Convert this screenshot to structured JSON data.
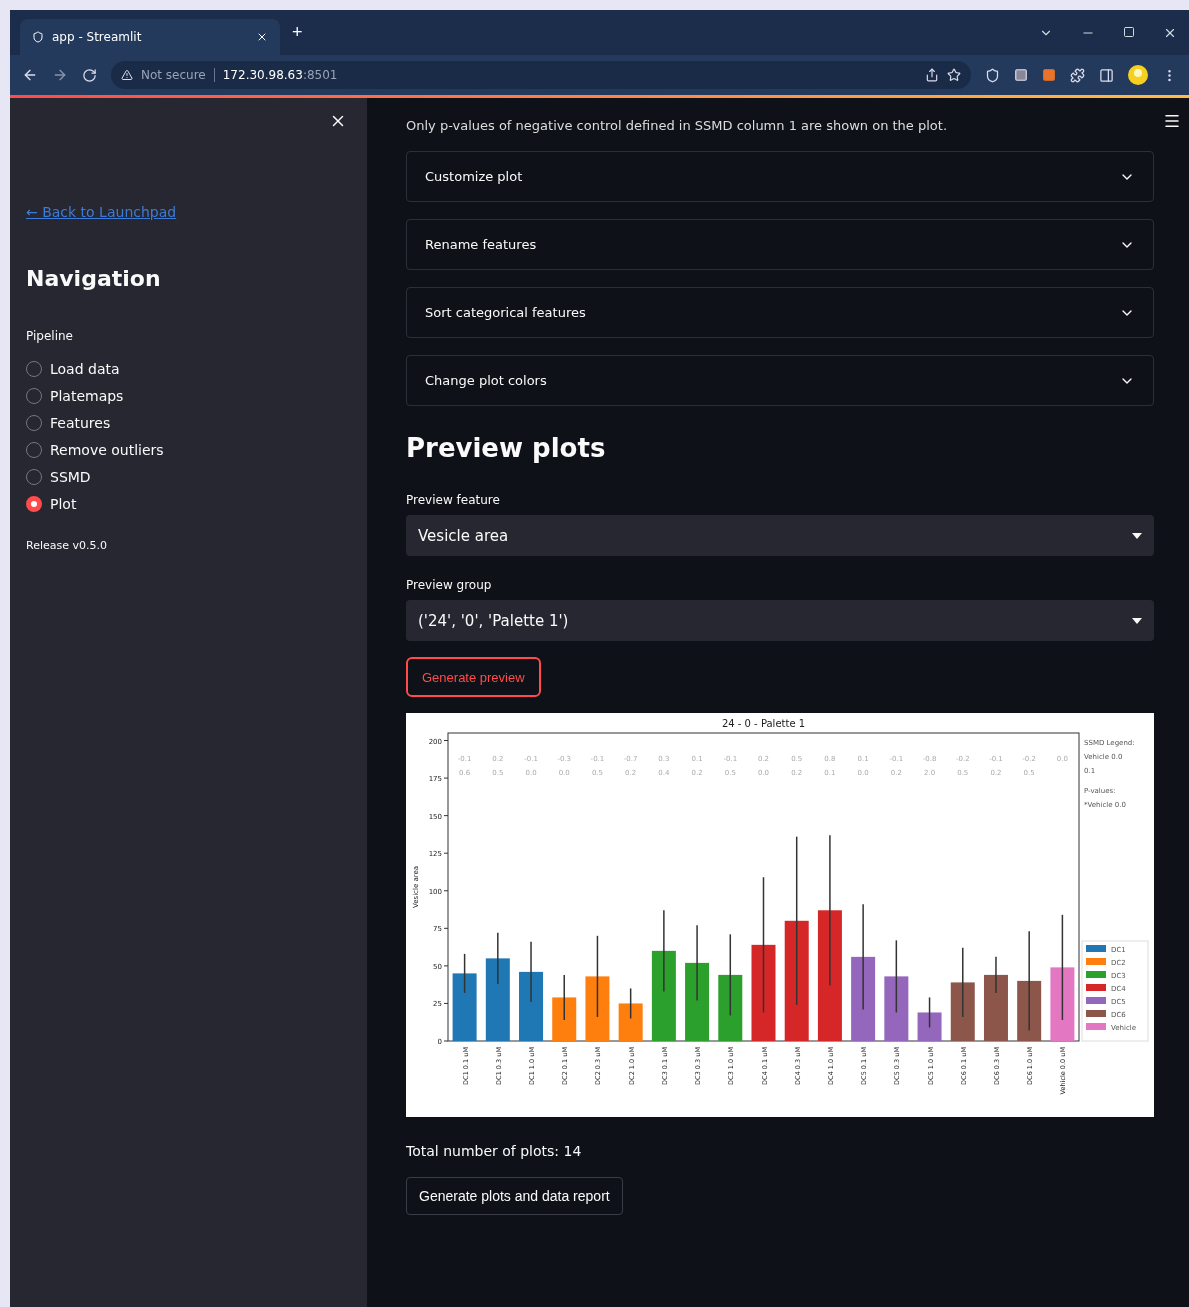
{
  "browser": {
    "tab_title": "app - Streamlit",
    "new_tab": "+",
    "security": "Not secure",
    "url": "172.30.98.63",
    "url_port": ":8501"
  },
  "sidebar": {
    "back_link": "← Back to Launchpad",
    "heading": "Navigation",
    "radio_label": "Pipeline",
    "items": [
      {
        "label": "Load data",
        "selected": false
      },
      {
        "label": "Platemaps",
        "selected": false
      },
      {
        "label": "Features",
        "selected": false
      },
      {
        "label": "Remove outliers",
        "selected": false
      },
      {
        "label": "SSMD",
        "selected": false
      },
      {
        "label": "Plot",
        "selected": true
      }
    ],
    "release": "Release v0.5.0"
  },
  "main": {
    "note": "Only p-values of negative control defined in SSMD column 1 are shown on the plot.",
    "expanders": [
      {
        "label": "Customize plot",
        "expanded": false
      },
      {
        "label": "Rename features",
        "expanded": false
      },
      {
        "label": "Sort categorical features",
        "expanded": false
      },
      {
        "label": "Change plot colors",
        "expanded": false
      }
    ],
    "heading": "Preview plots",
    "selects": [
      {
        "label": "Preview feature",
        "value": "Vesicle area"
      },
      {
        "label": "Preview group",
        "value": "('24', '0', 'Palette 1')"
      }
    ],
    "preview_button": "Generate preview",
    "plot": {
      "side_notes": [
        "SSMD Legend:",
        "Vehicle 0.0",
        "0.1",
        "P-values:",
        "*Vehicle 0.0"
      ],
      "chart_data": {
        "type": "bar",
        "title": "24 - 0 - Palette 1",
        "ylabel": "Vesicle area",
        "categories": [
          "DC1 0.1 uM",
          "DC1 0.3 uM",
          "DC1 1.0 uM",
          "DC2 0.1 uM",
          "DC2 0.3 uM",
          "DC2 1.0 uM",
          "DC3 0.1 uM",
          "DC3 0.3 uM",
          "DC3 1.0 uM",
          "DC4 0.1 uM",
          "DC4 0.3 uM",
          "DC4 1.0 uM",
          "DC5 0.1 uM",
          "DC5 0.3 uM",
          "DC5 1.0 uM",
          "DC6 0.1 uM",
          "DC6 0.3 uM",
          "DC6 1.0 uM",
          "Vehicle 0.0 uM"
        ],
        "ylim": [
          0,
          205
        ],
        "legend": "right",
        "yticks": [
          0,
          25,
          50,
          75,
          100,
          125,
          150,
          175,
          200
        ],
        "series": [
          {
            "name": "DC1",
            "color": "#1f77b4",
            "values": [
              45,
              55,
              46,
              null,
              null,
              null,
              null,
              null,
              null,
              null,
              null,
              null,
              null,
              null,
              null,
              null,
              null,
              null,
              null
            ],
            "errors": [
              13,
              17,
              20,
              null,
              null,
              null,
              null,
              null,
              null,
              null,
              null,
              null,
              null,
              null,
              null,
              null,
              null,
              null,
              null
            ]
          },
          {
            "name": "DC2",
            "color": "#ff7f0e",
            "values": [
              null,
              null,
              null,
              29,
              43,
              25,
              null,
              null,
              null,
              null,
              null,
              null,
              null,
              null,
              null,
              null,
              null,
              null,
              null
            ],
            "errors": [
              null,
              null,
              null,
              15,
              27,
              10,
              null,
              null,
              null,
              null,
              null,
              null,
              null,
              null,
              null,
              null,
              null,
              null,
              null
            ]
          },
          {
            "name": "DC3",
            "color": "#2ca02c",
            "values": [
              null,
              null,
              null,
              null,
              null,
              null,
              60,
              52,
              44,
              null,
              null,
              null,
              null,
              null,
              null,
              null,
              null,
              null,
              null
            ],
            "errors": [
              null,
              null,
              null,
              null,
              null,
              null,
              27,
              25,
              27,
              null,
              null,
              null,
              null,
              null,
              null,
              null,
              null,
              null,
              null
            ]
          },
          {
            "name": "DC4",
            "color": "#d62728",
            "values": [
              null,
              null,
              null,
              null,
              null,
              null,
              null,
              null,
              null,
              64,
              80,
              87,
              null,
              null,
              null,
              null,
              null,
              null,
              null
            ],
            "errors": [
              null,
              null,
              null,
              null,
              null,
              null,
              null,
              null,
              null,
              45,
              56,
              50,
              null,
              null,
              null,
              null,
              null,
              null,
              null
            ]
          },
          {
            "name": "DC5",
            "color": "#9467bd",
            "values": [
              null,
              null,
              null,
              null,
              null,
              null,
              null,
              null,
              null,
              null,
              null,
              null,
              56,
              43,
              19,
              null,
              null,
              null,
              null
            ],
            "errors": [
              null,
              null,
              null,
              null,
              null,
              null,
              null,
              null,
              null,
              null,
              null,
              null,
              35,
              24,
              10,
              null,
              null,
              null,
              null
            ]
          },
          {
            "name": "DC6",
            "color": "#8c564b",
            "values": [
              null,
              null,
              null,
              null,
              null,
              null,
              null,
              null,
              null,
              null,
              null,
              null,
              null,
              null,
              null,
              39,
              44,
              40,
              null
            ],
            "errors": [
              null,
              null,
              null,
              null,
              null,
              null,
              null,
              null,
              null,
              null,
              null,
              null,
              null,
              null,
              null,
              23,
              12,
              33,
              null
            ]
          },
          {
            "name": "Vehicle",
            "color": "#e377c2",
            "values": [
              null,
              null,
              null,
              null,
              null,
              null,
              null,
              null,
              null,
              null,
              null,
              null,
              null,
              null,
              null,
              null,
              null,
              null,
              49
            ],
            "errors": [
              null,
              null,
              null,
              null,
              null,
              null,
              null,
              null,
              null,
              null,
              null,
              null,
              null,
              null,
              null,
              null,
              null,
              null,
              35
            ]
          }
        ],
        "annotations": [
          "-0.1",
          "0.2",
          "-0.1",
          "-0.3",
          "-0.1",
          "-0.7",
          "0.3",
          "0.1",
          "-0.1",
          "0.2",
          "0.5",
          "0.8",
          "0.1",
          "-0.1",
          "-0.8",
          "-0.2",
          "-0.1",
          "-0.2",
          "0.0",
          "0.6",
          "0.5",
          "0.0",
          "0.0",
          "0.5",
          "0.2",
          "0.4",
          "0.2",
          "0.5",
          "0.0",
          "0.2",
          "0.1",
          "0.0",
          "0.2",
          "2.0",
          "0.5",
          "0.2",
          "0.5"
        ]
      }
    },
    "total": "Total number of plots: 14",
    "report_button": "Generate plots and data report"
  }
}
